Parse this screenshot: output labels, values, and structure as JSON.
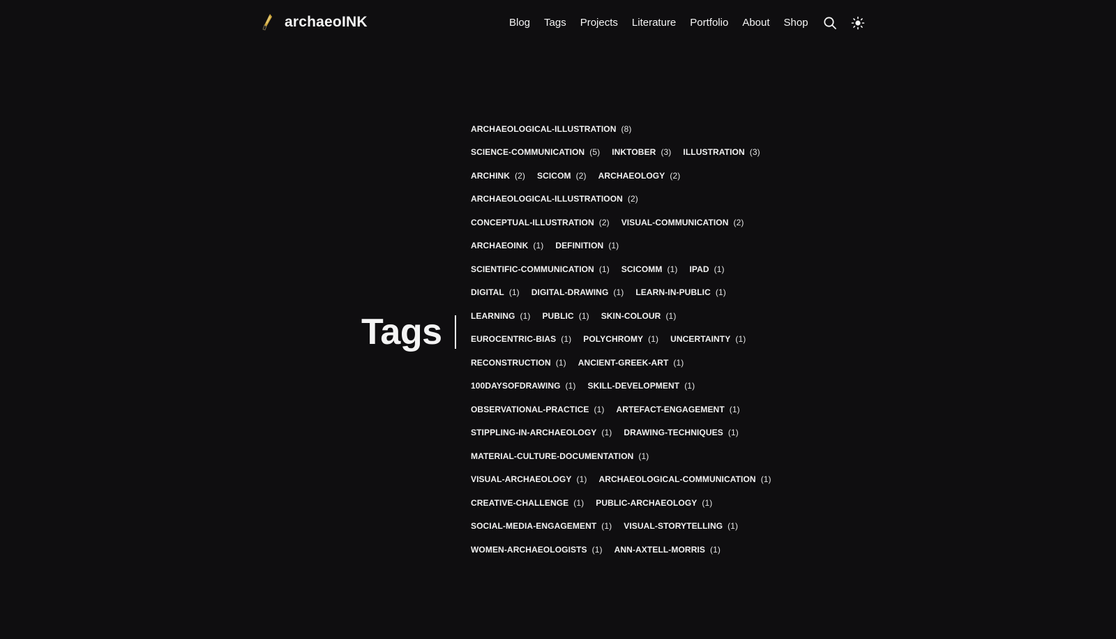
{
  "header": {
    "site_name": "archaeoINK",
    "nav": [
      "Blog",
      "Tags",
      "Projects",
      "Literature",
      "Portfolio",
      "About",
      "Shop"
    ],
    "icons": [
      "search-icon",
      "theme-toggle-sun-icon"
    ]
  },
  "page": {
    "title": "Tags"
  },
  "tag_rows": [
    [
      {
        "name": "archaeological-illustration",
        "count": "(8)"
      }
    ],
    [
      {
        "name": "science-communication",
        "count": "(5)"
      },
      {
        "name": "inktober",
        "count": "(3)"
      },
      {
        "name": "illustration",
        "count": "(3)"
      }
    ],
    [
      {
        "name": "archink",
        "count": "(2)"
      },
      {
        "name": "scicom",
        "count": "(2)"
      },
      {
        "name": "archaeology",
        "count": "(2)"
      }
    ],
    [
      {
        "name": "archaeological-illustratioon",
        "count": "(2)"
      }
    ],
    [
      {
        "name": "conceptual-illustration",
        "count": "(2)"
      },
      {
        "name": "visual-communication",
        "count": "(2)"
      }
    ],
    [
      {
        "name": "archaeoink",
        "count": "(1)"
      },
      {
        "name": "definition",
        "count": "(1)"
      }
    ],
    [
      {
        "name": "scientific-communication",
        "count": "(1)"
      },
      {
        "name": "scicomm",
        "count": "(1)"
      },
      {
        "name": "ipad",
        "count": "(1)"
      }
    ],
    [
      {
        "name": "digital",
        "count": "(1)"
      },
      {
        "name": "digital-drawing",
        "count": "(1)"
      },
      {
        "name": "learn-in-public",
        "count": "(1)"
      }
    ],
    [
      {
        "name": "learning",
        "count": "(1)"
      },
      {
        "name": "public",
        "count": "(1)"
      },
      {
        "name": "skin-colour",
        "count": "(1)"
      }
    ],
    [
      {
        "name": "eurocentric-bias",
        "count": "(1)"
      },
      {
        "name": "polychromy",
        "count": "(1)"
      },
      {
        "name": "uncertainty",
        "count": "(1)"
      }
    ],
    [
      {
        "name": "reconstruction",
        "count": "(1)"
      },
      {
        "name": "ancient-greek-art",
        "count": "(1)"
      }
    ],
    [
      {
        "name": "100daysofdrawing",
        "count": "(1)"
      },
      {
        "name": "skill-development",
        "count": "(1)"
      }
    ],
    [
      {
        "name": "observational-practice",
        "count": "(1)"
      },
      {
        "name": "artefact-engagement",
        "count": "(1)"
      }
    ],
    [
      {
        "name": "stippling-in-archaeology",
        "count": "(1)"
      },
      {
        "name": "drawing-techniques",
        "count": "(1)"
      }
    ],
    [
      {
        "name": "material-culture-documentation",
        "count": "(1)"
      }
    ],
    [
      {
        "name": "visual-archaeology",
        "count": "(1)"
      },
      {
        "name": "archaeological-communication",
        "count": "(1)"
      }
    ],
    [
      {
        "name": "creative-challenge",
        "count": "(1)"
      },
      {
        "name": "public-archaeology",
        "count": "(1)"
      }
    ],
    [
      {
        "name": "social-media-engagement",
        "count": "(1)"
      },
      {
        "name": "visual-storytelling",
        "count": "(1)"
      }
    ],
    [
      {
        "name": "women-archaeologists",
        "count": "(1)"
      },
      {
        "name": "ann-axtell-morris",
        "count": "(1)"
      }
    ]
  ],
  "colors": {
    "background": "#0f0e10",
    "text": "#f4f4f4",
    "logo_accent": "#c9a23a"
  }
}
